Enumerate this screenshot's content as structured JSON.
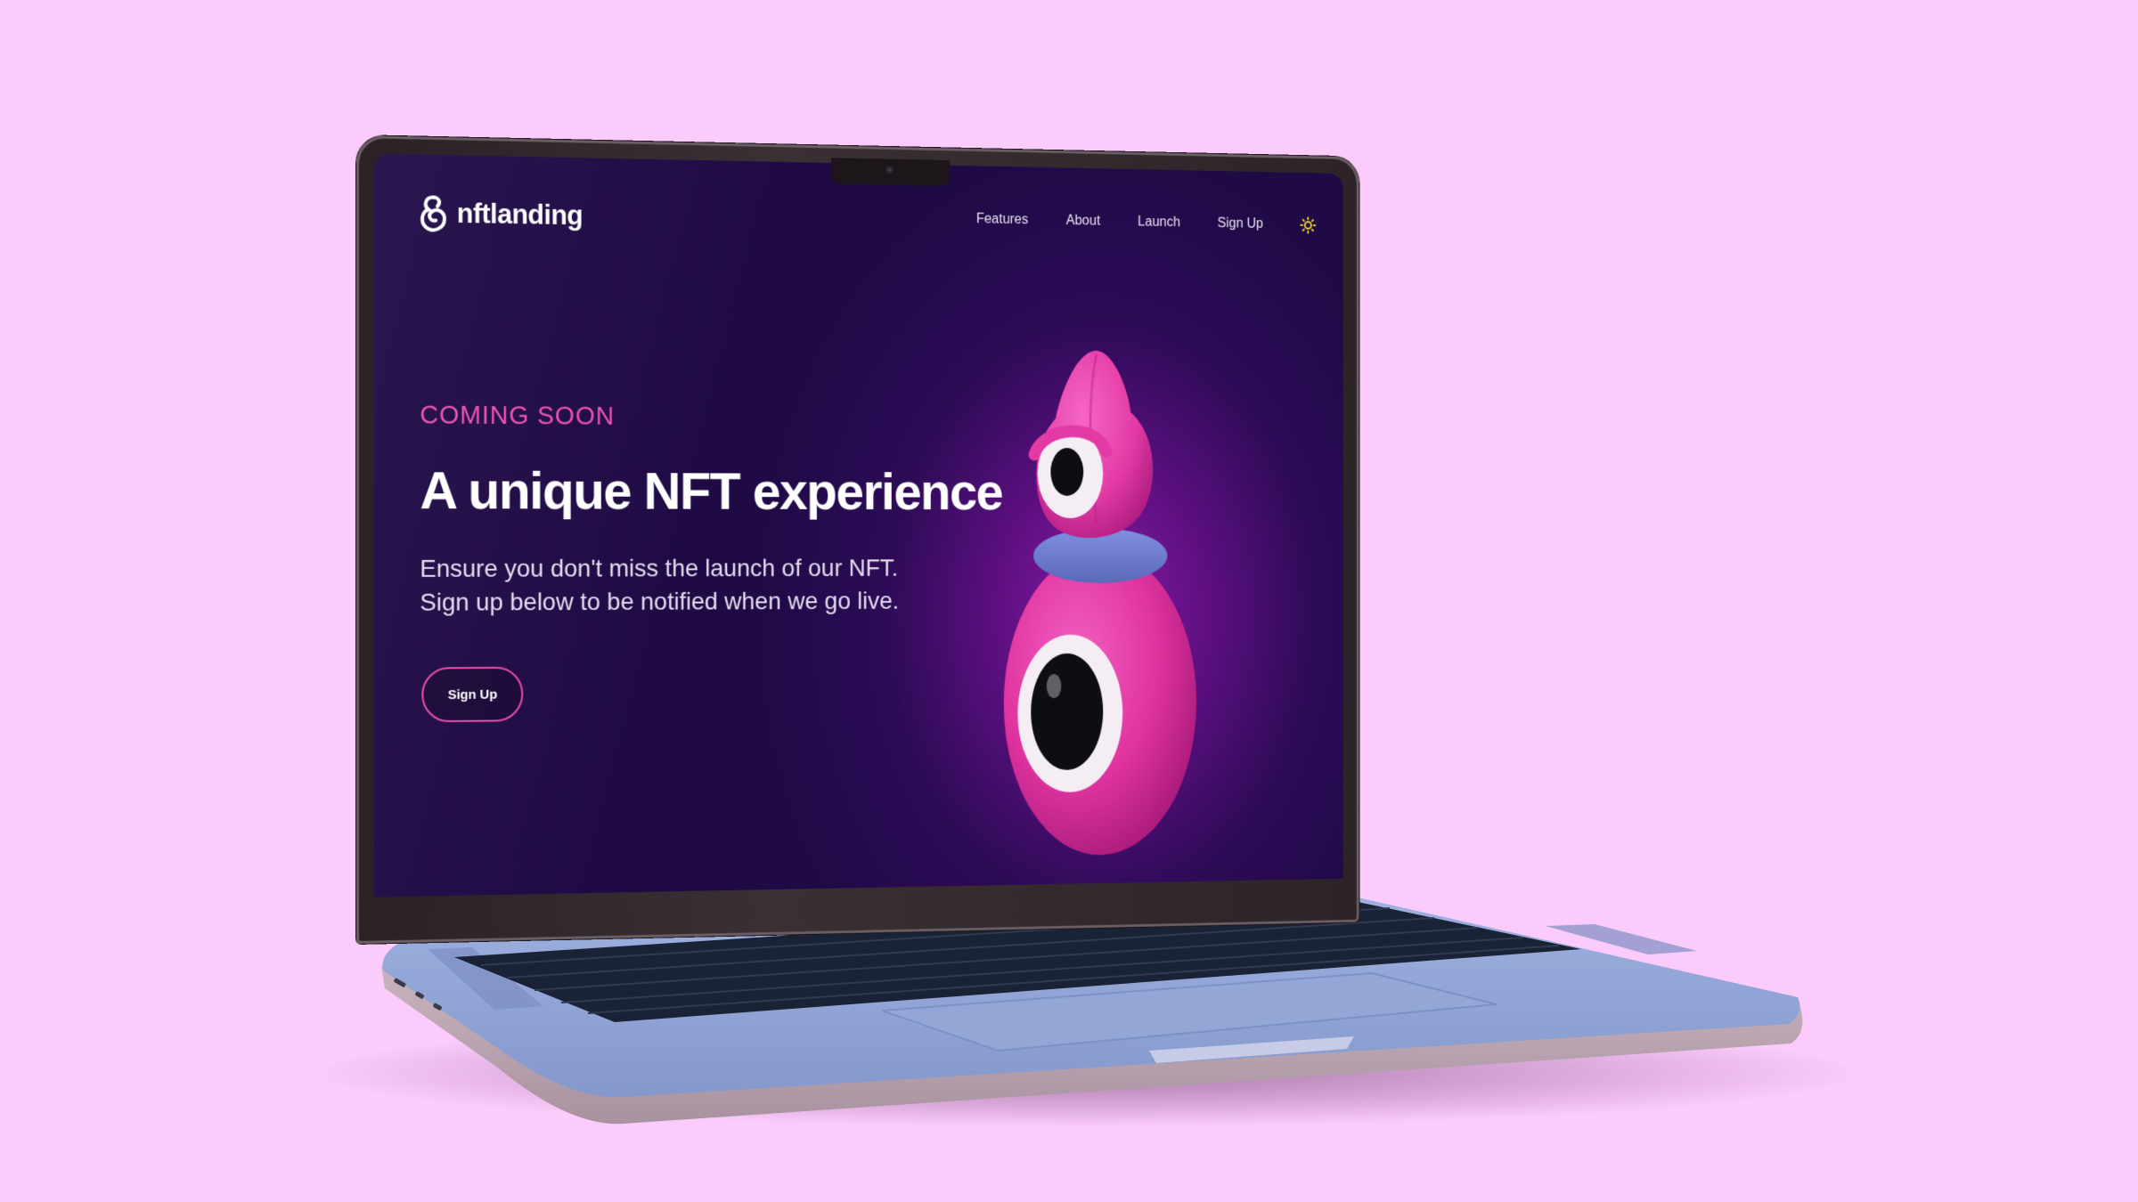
{
  "brand": {
    "name": "nftlanding",
    "logo_icon": "spiral-logo-icon"
  },
  "nav": {
    "items": [
      {
        "label": "Features"
      },
      {
        "label": "About"
      },
      {
        "label": "Launch"
      },
      {
        "label": "Sign Up"
      }
    ],
    "theme_toggle_icon": "sun-icon"
  },
  "hero": {
    "eyebrow": "COMING SOON",
    "title": "A unique NFT experience",
    "description": "Ensure you don't miss the launch of our NFT. Sign up below to be notified when we go live.",
    "button_label": "Sign Up"
  },
  "colors": {
    "page_background": "#fbcbfb",
    "screen_background": "#1f0a45",
    "accent_pink": "#ec4fb3",
    "character_pink": "#e0339f",
    "character_scarf": "#6f7fd0",
    "toggle_yellow": "#f5d33a",
    "laptop_body": "#8ea3d4"
  }
}
